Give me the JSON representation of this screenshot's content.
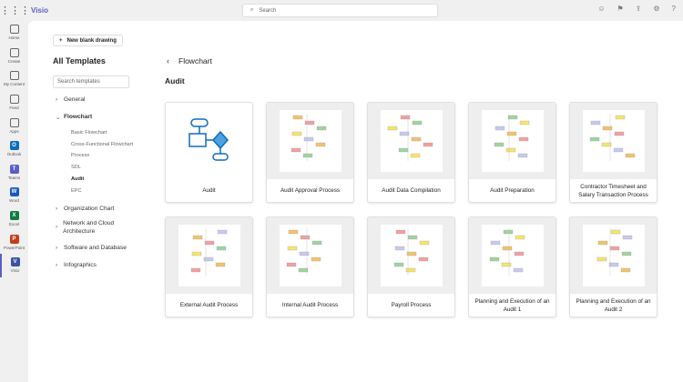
{
  "topbar": {
    "app_name": "Visio",
    "search_placeholder": "Search"
  },
  "rail": [
    {
      "label": "Home",
      "icon": "home-icon"
    },
    {
      "label": "Create",
      "icon": "plus-circle-icon"
    },
    {
      "label": "My Content",
      "icon": "folder-icon"
    },
    {
      "label": "Feed",
      "icon": "feed-icon"
    },
    {
      "label": "Apps",
      "icon": "apps-icon"
    },
    {
      "label": "Outlook",
      "icon": "outlook-icon",
      "color": "#0f6cbd",
      "letter": "O"
    },
    {
      "label": "Teams",
      "icon": "teams-icon",
      "color": "#5b5fc7",
      "letter": "T"
    },
    {
      "label": "Word",
      "icon": "word-icon",
      "color": "#185abd",
      "letter": "W"
    },
    {
      "label": "Excel",
      "icon": "excel-icon",
      "color": "#107c41",
      "letter": "X"
    },
    {
      "label": "PowerPoint",
      "icon": "powerpoint-icon",
      "color": "#c43e1c",
      "letter": "P"
    },
    {
      "label": "Visio",
      "icon": "visio-icon",
      "color": "#3955a3",
      "letter": "V"
    }
  ],
  "sidebar": {
    "new_blank": "New blank drawing",
    "title": "All Templates",
    "search_placeholder": "Search templates",
    "categories": [
      "General",
      "Flowchart",
      "Organization Chart",
      "Network and Cloud Architecture",
      "Software and Database",
      "Infographics"
    ],
    "flowchart_items": [
      "Basic Flowchart",
      "Cross-Functional Flowchart",
      "Process",
      "SDL",
      "Audit",
      "EPC"
    ]
  },
  "main": {
    "breadcrumb": "Flowchart",
    "section": "Audit",
    "templates": [
      "Audit",
      "Audit Approval Process",
      "Audit Data Compilation",
      "Audit Preparation",
      "Contractor Timesheet and Salary Transaction Process",
      "External Audit Process",
      "Internal Audit Process",
      "Payroll Process",
      "Planning and Execution of an Audit 1",
      "Planning and Execution of an Audit 2"
    ]
  },
  "colors": {
    "accent": "#5b5fc7",
    "diagram_blue": "#0f6cbd"
  }
}
